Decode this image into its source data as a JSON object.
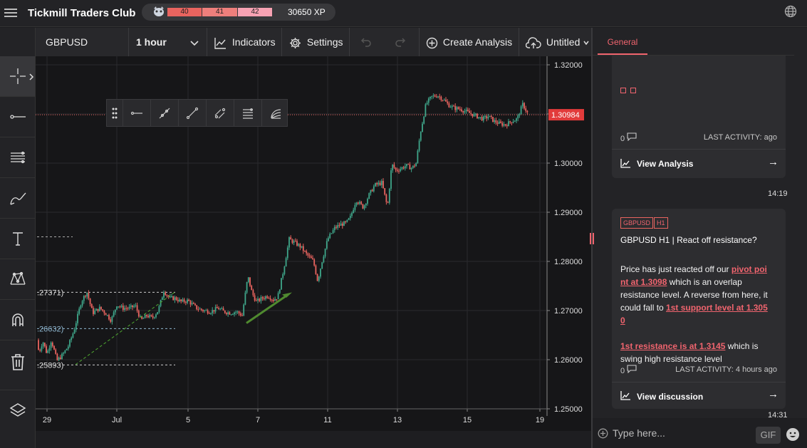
{
  "app": {
    "title": "Tickmill Traders Club",
    "xp_levels": [
      "40",
      "41",
      "42"
    ],
    "xp": "30650 XP"
  },
  "toolbar": {
    "symbol": "GBPUSD",
    "interval": "1 hour",
    "indicators": "Indicators",
    "settings": "Settings",
    "create_analysis": "Create Analysis",
    "layout_name": "Untitled"
  },
  "chart_data": {
    "type": "candlestick",
    "symbol": "GBPUSD",
    "interval": "1 hour",
    "y_ticks": [
      "1.32000",
      "1.31000",
      "1.30000",
      "1.29000",
      "1.28000",
      "1.27000",
      "1.26000",
      "1.25000"
    ],
    "ylim": [
      1.25,
      1.32
    ],
    "x_ticks": [
      "29",
      "Jul",
      "5",
      "7",
      "11",
      "13",
      "15",
      "19"
    ],
    "current_price": "1.30984",
    "price_path": [
      [
        0,
        1.264
      ],
      [
        5,
        1.2615
      ],
      [
        10,
        1.2638
      ],
      [
        16,
        1.2612
      ],
      [
        22,
        1.264
      ],
      [
        30,
        1.2598
      ],
      [
        38,
        1.261
      ],
      [
        46,
        1.2628
      ],
      [
        54,
        1.266
      ],
      [
        64,
        1.2718
      ],
      [
        72,
        1.2738
      ],
      [
        80,
        1.2695
      ],
      [
        90,
        1.2705
      ],
      [
        98,
        1.2695
      ],
      [
        106,
        1.268
      ],
      [
        114,
        1.2712
      ],
      [
        122,
        1.2705
      ],
      [
        132,
        1.2705
      ],
      [
        140,
        1.271
      ],
      [
        148,
        1.268
      ],
      [
        156,
        1.269
      ],
      [
        164,
        1.2685
      ],
      [
        172,
        1.27
      ],
      [
        180,
        1.274
      ],
      [
        188,
        1.2725
      ],
      [
        196,
        1.2725
      ],
      [
        204,
        1.2718
      ],
      [
        214,
        1.272
      ],
      [
        226,
        1.2705
      ],
      [
        236,
        1.27
      ],
      [
        246,
        1.2698
      ],
      [
        256,
        1.2705
      ],
      [
        264,
        1.2698
      ],
      [
        274,
        1.2695
      ],
      [
        282,
        1.2698
      ],
      [
        290,
        1.269
      ],
      [
        298,
        1.277
      ],
      [
        304,
        1.2735
      ],
      [
        310,
        1.2718
      ],
      [
        318,
        1.2725
      ],
      [
        326,
        1.273
      ],
      [
        334,
        1.2722
      ],
      [
        340,
        1.2728
      ],
      [
        348,
        1.2782
      ],
      [
        356,
        1.2845
      ],
      [
        364,
        1.2838
      ],
      [
        372,
        1.283
      ],
      [
        380,
        1.2815
      ],
      [
        390,
        1.28
      ],
      [
        396,
        1.276
      ],
      [
        402,
        1.28
      ],
      [
        410,
        1.2845
      ],
      [
        420,
        1.2868
      ],
      [
        428,
        1.2875
      ],
      [
        436,
        1.2878
      ],
      [
        442,
        1.289
      ],
      [
        450,
        1.2925
      ],
      [
        460,
        1.291
      ],
      [
        468,
        1.2935
      ],
      [
        476,
        1.2955
      ],
      [
        486,
        1.296
      ],
      [
        494,
        1.291
      ],
      [
        500,
        1.2998
      ],
      [
        506,
        1.2985
      ],
      [
        514,
        1.299
      ],
      [
        520,
        1.2995
      ],
      [
        528,
        1.299
      ],
      [
        534,
        1.2998
      ],
      [
        540,
        1.306
      ],
      [
        548,
        1.312
      ],
      [
        556,
        1.3135
      ],
      [
        564,
        1.3138
      ],
      [
        572,
        1.313
      ],
      [
        580,
        1.3118
      ],
      [
        588,
        1.3112
      ],
      [
        596,
        1.311
      ],
      [
        604,
        1.3105
      ],
      [
        612,
        1.31
      ],
      [
        620,
        1.3095
      ],
      [
        628,
        1.309
      ],
      [
        636,
        1.3095
      ],
      [
        644,
        1.3085
      ],
      [
        652,
        1.308
      ],
      [
        660,
        1.3078
      ],
      [
        668,
        1.3085
      ],
      [
        676,
        1.309
      ],
      [
        684,
        1.312
      ],
      [
        692,
        1.3098
      ]
    ],
    "drawings": {
      "support_lines": [
        {
          "price": 1.27371,
          "label": ".27371)"
        },
        {
          "price": 1.26632,
          "label": ".26632)"
        },
        {
          "price": 1.25893,
          "label": ".25893)"
        }
      ],
      "level_line": 1.285
    }
  },
  "feed": {
    "tab": "General",
    "card1": {
      "comments": "0",
      "last_activity": "LAST ACTIVITY: ago",
      "action": "View Analysis",
      "time": "14:19"
    },
    "card2": {
      "tags": [
        "GBPUSD",
        "H1"
      ],
      "title": "GBPUSD H1 | React off resistance?",
      "p1_a": "Price has just reacted off our ",
      "p1_link1": "pivot point at 1.3098",
      "p1_b": " which is an overlap resistance level. A reverse from here, it could fall to ",
      "p1_link2": "1st support level at 1.3050",
      "p2_link": "1st resistance is at 1.3145",
      "p2_b": " which is swing high resistance level",
      "comments": "0",
      "last_activity": "LAST ACTIVITY: 4 hours ago",
      "action": "View discussion",
      "time": "14:31"
    },
    "input_placeholder": "Type here...",
    "gif": "GIF"
  },
  "colors": {
    "up": "#3fa68a",
    "down": "#e9645f",
    "accent": "#f0646e",
    "drawing_green": "#4f8a2f"
  }
}
